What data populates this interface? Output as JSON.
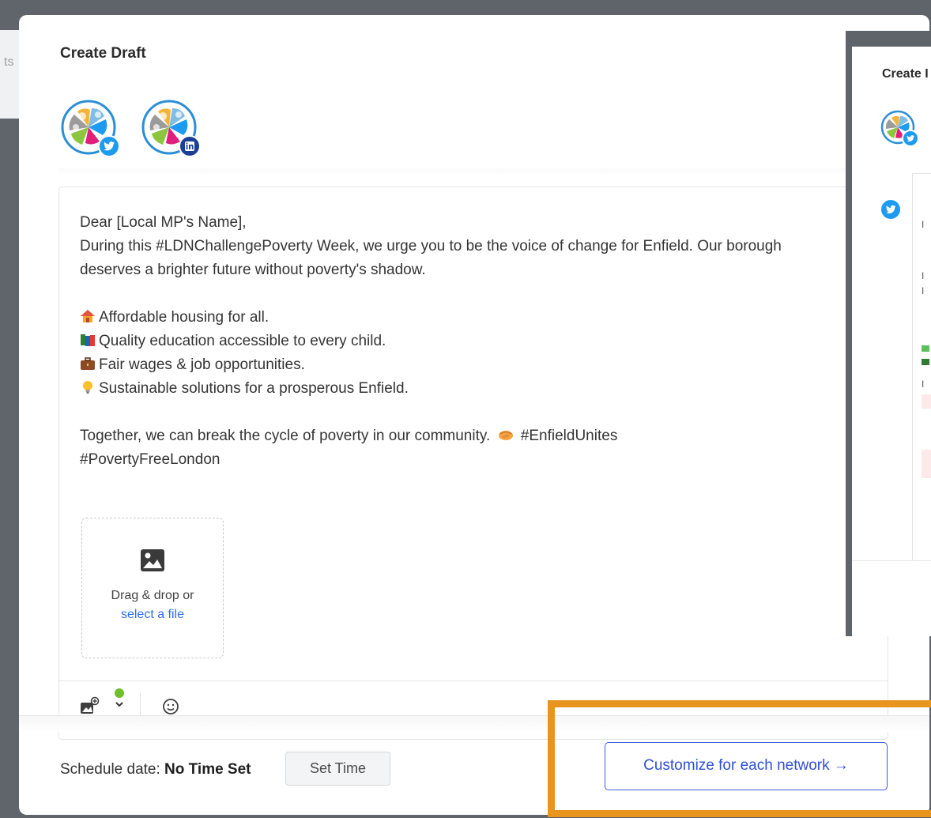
{
  "modal": {
    "title": "Create Draft",
    "accounts": [
      {
        "network": "twitter",
        "badge_icon": "twitter-bird-icon"
      },
      {
        "network": "linkedin",
        "badge_icon": "linkedin-in-icon"
      }
    ],
    "post": {
      "lines": [
        "Dear [Local MP's Name],",
        "During this #LDNChallengePoverty Week, we urge you to be the voice of change for Enfield. Our borough deserves a brighter future without poverty's shadow.",
        "",
        "Affordable housing for all.",
        "Quality education accessible to every child.",
        "Fair wages & job opportunities.",
        "Sustainable solutions for a prosperous Enfield.",
        "",
        "Together, we can break the cycle of poverty in our community.",
        "#EnfieldUnites",
        "#PovertyFreeLondon"
      ]
    },
    "dropzone": {
      "text": "Drag & drop or",
      "link": "select a file"
    },
    "footer": {
      "schedule_label": "Schedule date:",
      "schedule_value": "No Time Set",
      "set_time_button": "Set Time",
      "customize_button": "Customize for each network →"
    }
  },
  "background_modal": {
    "title": "Create I"
  },
  "colors": {
    "accent": "#2f4fd6",
    "highlight": "#e8951e",
    "twitter": "#1d9bf0",
    "linkedin": "#0a66c2",
    "link": "#2f6fe4"
  }
}
